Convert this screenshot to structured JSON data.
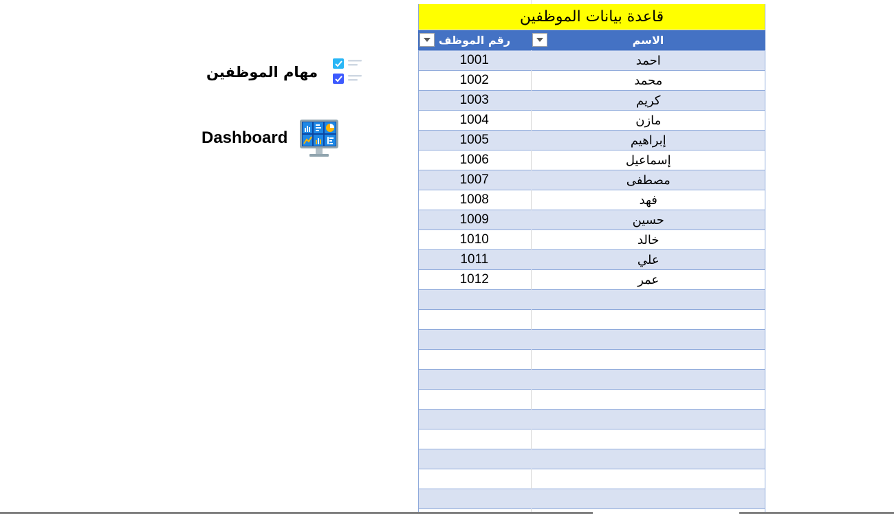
{
  "sheet": {
    "title": "قاعدة بيانات الموظفين",
    "columns": {
      "name": "الاسم",
      "id": "رقم الموظف"
    },
    "rows": [
      {
        "name": "احمد",
        "id": "1001"
      },
      {
        "name": "محمد",
        "id": "1002"
      },
      {
        "name": "كريم",
        "id": "1003"
      },
      {
        "name": "مازن",
        "id": "1004"
      },
      {
        "name": "إبراهيم",
        "id": "1005"
      },
      {
        "name": "إسماعيل",
        "id": "1006"
      },
      {
        "name": "مصطفى",
        "id": "1007"
      },
      {
        "name": "فهد",
        "id": "1008"
      },
      {
        "name": "حسين",
        "id": "1009"
      },
      {
        "name": "خالد",
        "id": "1010"
      },
      {
        "name": "علي",
        "id": "1011"
      },
      {
        "name": "عمر",
        "id": "1012"
      },
      {
        "name": "",
        "id": ""
      },
      {
        "name": "",
        "id": ""
      },
      {
        "name": "",
        "id": ""
      },
      {
        "name": "",
        "id": ""
      },
      {
        "name": "",
        "id": ""
      },
      {
        "name": "",
        "id": ""
      },
      {
        "name": "",
        "id": ""
      },
      {
        "name": "",
        "id": ""
      },
      {
        "name": "",
        "id": ""
      },
      {
        "name": "",
        "id": ""
      },
      {
        "name": "",
        "id": ""
      },
      {
        "name": "",
        "id": ""
      }
    ]
  },
  "shortcuts": {
    "tasks": {
      "label": "مهام الموظفين",
      "icon": "task-checklist-icon"
    },
    "dashboard": {
      "label": "Dashboard",
      "icon": "dashboard-monitor-icon"
    }
  },
  "colors": {
    "title_bg": "#ffff00",
    "header_bg": "#4472c4",
    "band_bg": "#d9e1f2"
  }
}
